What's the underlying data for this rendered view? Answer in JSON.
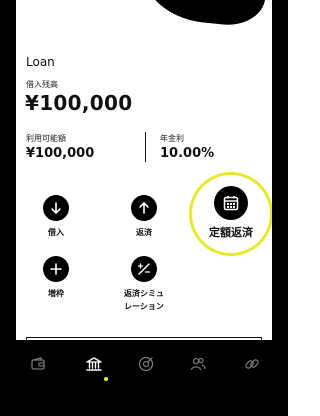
{
  "account": {
    "title": "Loan",
    "balance_label": "借入残高",
    "balance_value": "¥100,000",
    "available_label": "利用可能額",
    "available_value": "¥100,000",
    "rate_label": "年金利",
    "rate_value": "10.00%"
  },
  "actions": {
    "borrow": "借入",
    "repay": "返済",
    "fixed_repay": "定額返済",
    "increase": "増枠",
    "simulation_line1": "返済シミュ",
    "simulation_line2": "レーション"
  },
  "tabbar": {
    "active_tab": "bank",
    "accent_color": "#e7ea2a",
    "icons": [
      "wallet-icon",
      "bank-icon",
      "target-icon",
      "people-icon",
      "link-icon"
    ]
  },
  "colors": {
    "background": "#ffffff",
    "primary": "#000000",
    "highlight": "#e7ea2a"
  }
}
